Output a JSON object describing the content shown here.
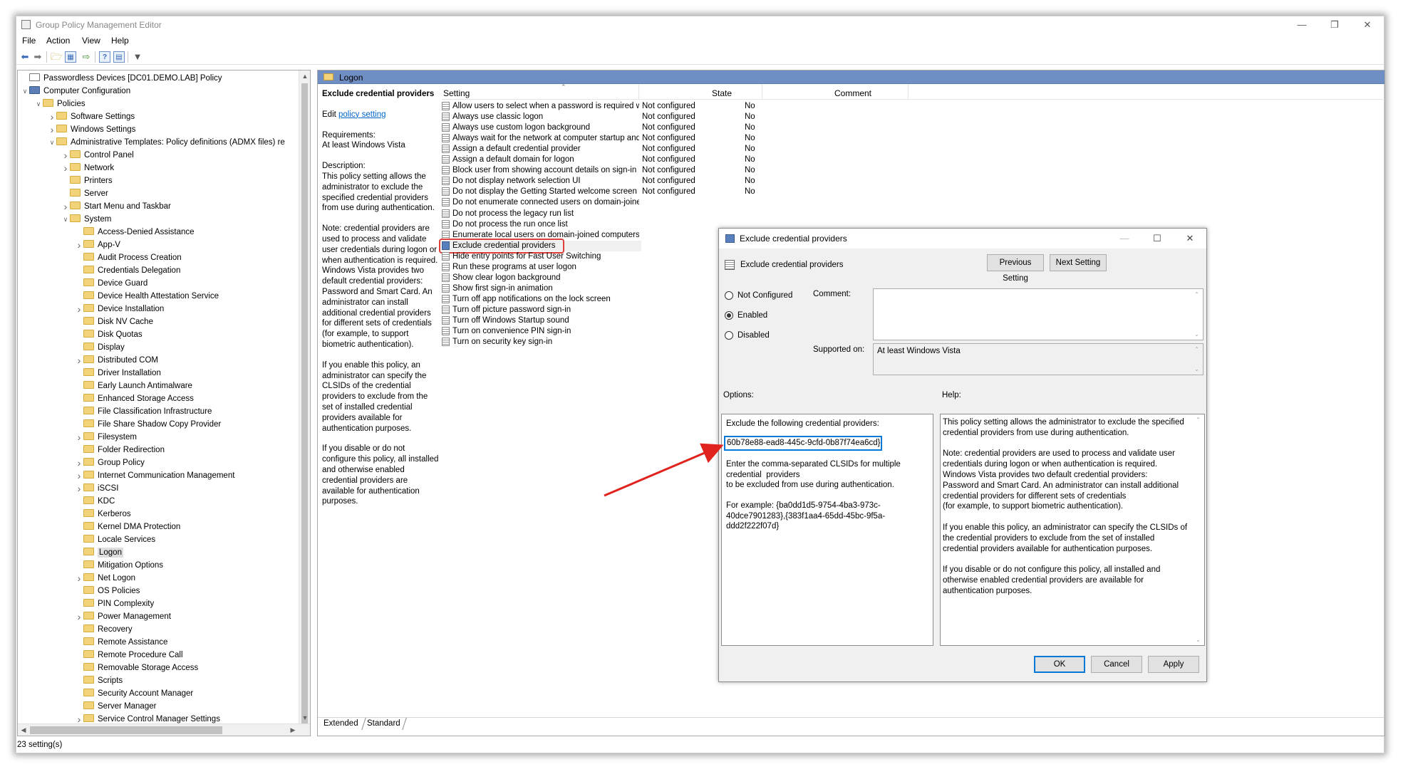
{
  "window": {
    "title": "Group Policy Management Editor",
    "status": "23 setting(s)"
  },
  "menu": [
    "File",
    "Action",
    "View",
    "Help"
  ],
  "tree": [
    {
      "label": "Passwordless Devices [DC01.DEMO.LAB] Policy",
      "level": 0,
      "exp": "",
      "icon": "policy"
    },
    {
      "label": "Computer Configuration",
      "level": 0,
      "exp": "v",
      "icon": "computer"
    },
    {
      "label": "Policies",
      "level": 1,
      "exp": "v",
      "icon": "folder"
    },
    {
      "label": "Software Settings",
      "level": 2,
      "exp": ">",
      "icon": "folder"
    },
    {
      "label": "Windows Settings",
      "level": 2,
      "exp": ">",
      "icon": "folder"
    },
    {
      "label": "Administrative Templates: Policy definitions (ADMX files) re",
      "level": 2,
      "exp": "v",
      "icon": "folder"
    },
    {
      "label": "Control Panel",
      "level": 3,
      "exp": ">",
      "icon": "folder"
    },
    {
      "label": "Network",
      "level": 3,
      "exp": ">",
      "icon": "folder"
    },
    {
      "label": "Printers",
      "level": 3,
      "exp": "",
      "icon": "folder"
    },
    {
      "label": "Server",
      "level": 3,
      "exp": "",
      "icon": "folder"
    },
    {
      "label": "Start Menu and Taskbar",
      "level": 3,
      "exp": ">",
      "icon": "folder"
    },
    {
      "label": "System",
      "level": 3,
      "exp": "v",
      "icon": "folder"
    },
    {
      "label": "Access-Denied Assistance",
      "level": 4,
      "exp": "",
      "icon": "folder"
    },
    {
      "label": "App-V",
      "level": 4,
      "exp": ">",
      "icon": "folder"
    },
    {
      "label": "Audit Process Creation",
      "level": 4,
      "exp": "",
      "icon": "folder"
    },
    {
      "label": "Credentials Delegation",
      "level": 4,
      "exp": "",
      "icon": "folder"
    },
    {
      "label": "Device Guard",
      "level": 4,
      "exp": "",
      "icon": "folder"
    },
    {
      "label": "Device Health Attestation Service",
      "level": 4,
      "exp": "",
      "icon": "folder"
    },
    {
      "label": "Device Installation",
      "level": 4,
      "exp": ">",
      "icon": "folder"
    },
    {
      "label": "Disk NV Cache",
      "level": 4,
      "exp": "",
      "icon": "folder"
    },
    {
      "label": "Disk Quotas",
      "level": 4,
      "exp": "",
      "icon": "folder"
    },
    {
      "label": "Display",
      "level": 4,
      "exp": "",
      "icon": "folder"
    },
    {
      "label": "Distributed COM",
      "level": 4,
      "exp": ">",
      "icon": "folder"
    },
    {
      "label": "Driver Installation",
      "level": 4,
      "exp": "",
      "icon": "folder"
    },
    {
      "label": "Early Launch Antimalware",
      "level": 4,
      "exp": "",
      "icon": "folder"
    },
    {
      "label": "Enhanced Storage Access",
      "level": 4,
      "exp": "",
      "icon": "folder"
    },
    {
      "label": "File Classification Infrastructure",
      "level": 4,
      "exp": "",
      "icon": "folder"
    },
    {
      "label": "File Share Shadow Copy Provider",
      "level": 4,
      "exp": "",
      "icon": "folder"
    },
    {
      "label": "Filesystem",
      "level": 4,
      "exp": ">",
      "icon": "folder"
    },
    {
      "label": "Folder Redirection",
      "level": 4,
      "exp": "",
      "icon": "folder"
    },
    {
      "label": "Group Policy",
      "level": 4,
      "exp": ">",
      "icon": "folder"
    },
    {
      "label": "Internet Communication Management",
      "level": 4,
      "exp": ">",
      "icon": "folder"
    },
    {
      "label": "iSCSI",
      "level": 4,
      "exp": ">",
      "icon": "folder"
    },
    {
      "label": "KDC",
      "level": 4,
      "exp": "",
      "icon": "folder"
    },
    {
      "label": "Kerberos",
      "level": 4,
      "exp": "",
      "icon": "folder"
    },
    {
      "label": "Kernel DMA Protection",
      "level": 4,
      "exp": "",
      "icon": "folder"
    },
    {
      "label": "Locale Services",
      "level": 4,
      "exp": "",
      "icon": "folder"
    },
    {
      "label": "Logon",
      "level": 4,
      "exp": "",
      "icon": "folder",
      "selected": true
    },
    {
      "label": "Mitigation Options",
      "level": 4,
      "exp": "",
      "icon": "folder"
    },
    {
      "label": "Net Logon",
      "level": 4,
      "exp": ">",
      "icon": "folder"
    },
    {
      "label": "OS Policies",
      "level": 4,
      "exp": "",
      "icon": "folder"
    },
    {
      "label": "PIN Complexity",
      "level": 4,
      "exp": "",
      "icon": "folder"
    },
    {
      "label": "Power Management",
      "level": 4,
      "exp": ">",
      "icon": "folder"
    },
    {
      "label": "Recovery",
      "level": 4,
      "exp": "",
      "icon": "folder"
    },
    {
      "label": "Remote Assistance",
      "level": 4,
      "exp": "",
      "icon": "folder"
    },
    {
      "label": "Remote Procedure Call",
      "level": 4,
      "exp": "",
      "icon": "folder"
    },
    {
      "label": "Removable Storage Access",
      "level": 4,
      "exp": "",
      "icon": "folder"
    },
    {
      "label": "Scripts",
      "level": 4,
      "exp": "",
      "icon": "folder"
    },
    {
      "label": "Security Account Manager",
      "level": 4,
      "exp": "",
      "icon": "folder"
    },
    {
      "label": "Server Manager",
      "level": 4,
      "exp": "",
      "icon": "folder"
    },
    {
      "label": "Service Control Manager Settings",
      "level": 4,
      "exp": ">",
      "icon": "folder"
    }
  ],
  "pane": {
    "header": "Logon",
    "desc_title": "Exclude credential providers",
    "edit_prefix": "Edit ",
    "edit_link": "policy setting",
    "requirements": "Requirements:\nAt least Windows Vista",
    "description": "Description:\nThis policy setting allows the administrator to exclude the specified credential providers from use during authentication.",
    "note": "Note: credential providers are used to process and validate user credentials during logon or when authentication is required.\nWindows Vista provides two default credential providers:\nPassword and Smart Card. An administrator can install additional credential providers for different sets of credentials\n(for example, to support biometric authentication).",
    "enable": "If you enable this policy, an administrator can specify the CLSIDs of the credential providers to exclude from the set of installed credential providers available for authentication purposes.",
    "disable": "If you disable or do not configure this policy, all installed and otherwise enabled credential providers are available for authentication purposes.",
    "col_setting": "Setting",
    "col_state": "State",
    "col_comment": "Comment",
    "tab_extended": "Extended",
    "tab_standard": "Standard"
  },
  "policies": [
    {
      "name": "Allow users to select when a password is required when resu...",
      "state": "Not configured",
      "comment": "No"
    },
    {
      "name": "Always use classic logon",
      "state": "Not configured",
      "comment": "No"
    },
    {
      "name": "Always use custom logon background",
      "state": "Not configured",
      "comment": "No"
    },
    {
      "name": "Always wait for the network at computer startup and logon",
      "state": "Not configured",
      "comment": "No"
    },
    {
      "name": "Assign a default credential provider",
      "state": "Not configured",
      "comment": "No"
    },
    {
      "name": "Assign a default domain for logon",
      "state": "Not configured",
      "comment": "No"
    },
    {
      "name": "Block user from showing account details on sign-in",
      "state": "Not configured",
      "comment": "No"
    },
    {
      "name": "Do not display network selection UI",
      "state": "Not configured",
      "comment": "No"
    },
    {
      "name": "Do not display the Getting Started welcome screen at logon",
      "state": "Not configured",
      "comment": "No"
    },
    {
      "name": "Do not enumerate connected users on domain-joined com...",
      "state": "",
      "comment": ""
    },
    {
      "name": "Do not process the legacy run list",
      "state": "",
      "comment": ""
    },
    {
      "name": "Do not process the run once list",
      "state": "",
      "comment": ""
    },
    {
      "name": "Enumerate local users on domain-joined computers",
      "state": "",
      "comment": ""
    },
    {
      "name": "Exclude credential providers",
      "state": "",
      "comment": "",
      "highlight": true
    },
    {
      "name": "Hide entry points for Fast User Switching",
      "state": "",
      "comment": ""
    },
    {
      "name": "Run these programs at user logon",
      "state": "",
      "comment": ""
    },
    {
      "name": "Show clear logon background",
      "state": "",
      "comment": ""
    },
    {
      "name": "Show first sign-in animation",
      "state": "",
      "comment": ""
    },
    {
      "name": "Turn off app notifications on the lock screen",
      "state": "",
      "comment": ""
    },
    {
      "name": "Turn off picture password sign-in",
      "state": "",
      "comment": ""
    },
    {
      "name": "Turn off Windows Startup sound",
      "state": "",
      "comment": ""
    },
    {
      "name": "Turn on convenience PIN sign-in",
      "state": "",
      "comment": ""
    },
    {
      "name": "Turn on security key sign-in",
      "state": "",
      "comment": ""
    }
  ],
  "dialog": {
    "title": "Exclude credential providers",
    "policy_name": "Exclude credential providers",
    "prev_btn": "Previous Setting",
    "next_btn": "Next Setting",
    "radio_not_configured": "Not Configured",
    "radio_enabled": "Enabled",
    "radio_disabled": "Disabled",
    "selected_radio": "enabled",
    "comment_label": "Comment:",
    "supported_label": "Supported on:",
    "supported_value": "At least Windows Vista",
    "options_label": "Options:",
    "help_label": "Help:",
    "option_label": "Exclude the following credential providers:",
    "option_value": "60b78e88-ead8-445c-9cfd-0b87f74ea6cd}",
    "option_help": "Enter the comma-separated CLSIDs for multiple\ncredential  providers\nto be excluded from use during authentication.\n\nFor example: {ba0dd1d5-9754-4ba3-973c-\n40dce7901283},{383f1aa4-65dd-45bc-9f5a-\nddd2f222f07d}",
    "help_text": "This policy setting allows the administrator to exclude the specified\ncredential providers from use during authentication.\n\nNote: credential providers are used to process and validate user credentials during logon or when authentication is required.\nWindows Vista provides two default credential providers:\nPassword and Smart Card. An administrator can install additional credential providers for different sets of credentials\n(for example, to support biometric authentication).\n\nIf you enable this policy, an administrator can specify the CLSIDs of the credential providers to exclude from the set of installed credential providers available for authentication purposes.\n\nIf you disable or do not configure this policy, all installed and otherwise enabled credential providers are available for authentication purposes.",
    "ok": "OK",
    "cancel": "Cancel",
    "apply": "Apply"
  },
  "colors": {
    "pane_header": "#6f8fc4",
    "highlight_ring": "#e0403a",
    "annotation_arrow": "#e0231c",
    "focus": "#0078d7"
  }
}
